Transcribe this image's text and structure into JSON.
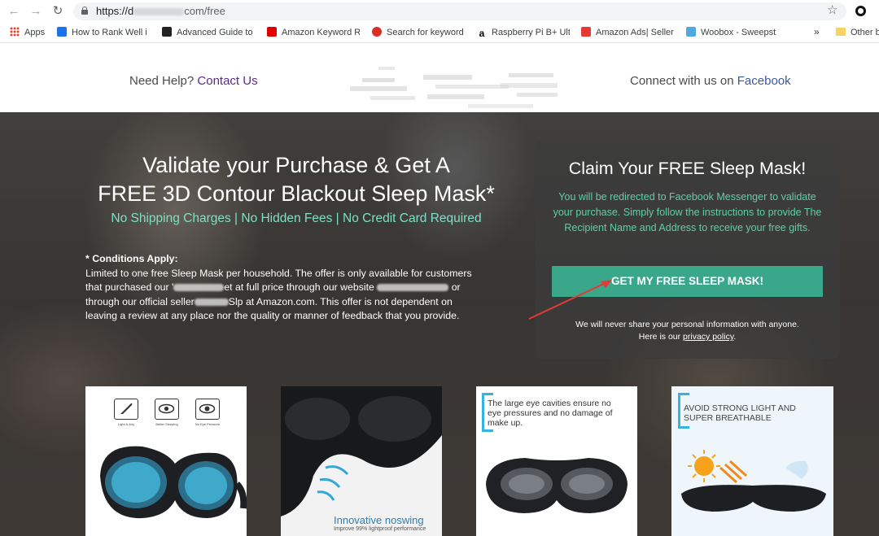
{
  "browser": {
    "url_prefix": "https://d",
    "url_domain_tail": "com/free",
    "bookmarks": [
      {
        "label": "Apps",
        "color": "#e94235"
      },
      {
        "label": "How to Rank Well i",
        "color": "#1a73e8"
      },
      {
        "label": "Advanced Guide to",
        "color": "#222222"
      },
      {
        "label": "Amazon Keyword R",
        "color": "#e00000"
      },
      {
        "label": "Search for keyword",
        "color": "#d93025"
      },
      {
        "label": "Raspberry Pi B+ Ult",
        "color": "#000000"
      },
      {
        "label": "Amazon Ads| Seller",
        "color": "#e53935"
      },
      {
        "label": "Woobox - Sweepst",
        "color": "#4fa8e0"
      }
    ],
    "more_label": "»",
    "other_bookmarks": "Other b"
  },
  "header": {
    "help_text": "Need Help?",
    "help_link": "Contact Us",
    "connect_text": "Connect with us on",
    "connect_link": "Facebook"
  },
  "hero": {
    "headline_line1": "Validate your Purchase & Get A",
    "headline_line2": "FREE 3D Contour Blackout Sleep Mask*",
    "tagline": "No Shipping Charges | No Hidden Fees | No Credit Card Required",
    "conditions_title": "* Conditions Apply:",
    "conditions_p1": "Limited to one free Sleep Mask  per household. The offer is only available for customers",
    "conditions_p2a": "that purchased our '",
    "conditions_p2b": "et at full price through our website",
    "conditions_p2c": "or",
    "conditions_p3a": "through our official seller",
    "conditions_p3b": "Slp at Amazon.com. This offer is not dependent on",
    "conditions_p4": "leaving a review at any place nor the quality or manner of feedback that you provide."
  },
  "claim": {
    "title": "Claim Your FREE Sleep Mask!",
    "text": "You will be redirected to Facebook Messenger to validate your purchase. Simply follow the instructions to provide The Recipient Name and Address to receive your free gifts.",
    "button": "GET MY FREE SLEEP MASK!",
    "privacy_line1": "We will never share your personal information with anyone.",
    "privacy_line2": "Here is our",
    "privacy_link": "privacy policy",
    "privacy_end": "."
  },
  "cards": {
    "card1_features": [
      "Light & Airy",
      "Better Sleeping",
      "No Eye Pressure"
    ],
    "card2_title": "Innovative noswing",
    "card2_sub": "Improve 99% lightproof performance",
    "card3_note": "The large eye cavities ensure no eye pressures and no damage of make up.",
    "card4_note": "AVOID STRONG LIGHT AND SUPER BREATHABLE"
  },
  "colors": {
    "accent_green": "#3aa68a",
    "tagline_green": "#7ee0c4",
    "link_purple": "#5b2a86",
    "facebook_blue": "#3b5998"
  }
}
